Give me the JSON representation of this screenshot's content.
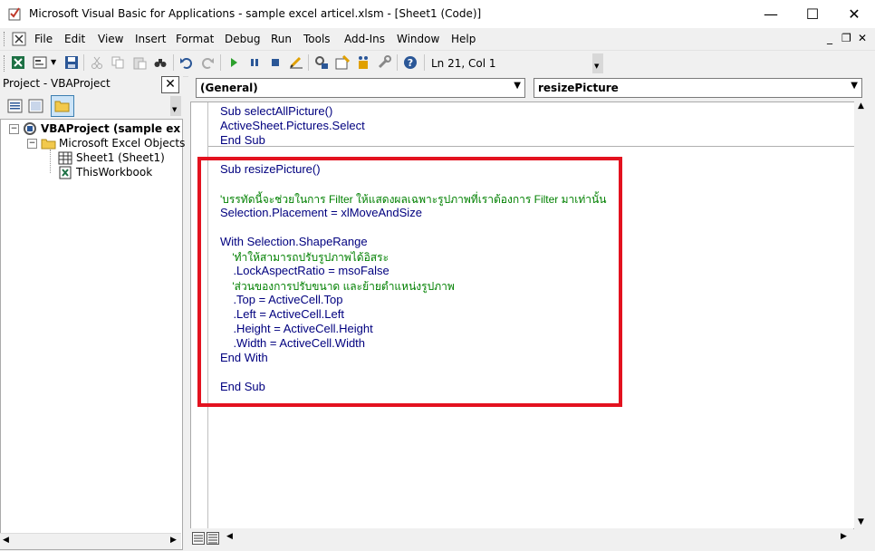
{
  "window": {
    "title": "Microsoft Visual Basic for Applications - sample excel articel.xlsm - [Sheet1 (Code)]",
    "minimize": "—",
    "maximize": "☐",
    "close": "✕"
  },
  "menu": {
    "items": [
      "File",
      "Edit",
      "View",
      "Insert",
      "Format",
      "Debug",
      "Run",
      "Tools",
      "Add-Ins",
      "Window",
      "Help"
    ],
    "mdi_minimize": "_",
    "mdi_restore": "❐",
    "mdi_close": "✕"
  },
  "toolbar": {
    "cursor_position": "Ln 21, Col 1"
  },
  "project": {
    "header": "Project - VBAProject",
    "close": "✕",
    "tree": {
      "root": "VBAProject (sample excel articel.xlsm)",
      "folder": "Microsoft Excel Objects",
      "items": [
        "Sheet1 (Sheet1)",
        "ThisWorkbook"
      ]
    }
  },
  "editor": {
    "object_combo": "(General)",
    "procedure_combo": "resizePicture",
    "block1": [
      "Sub selectAllPicture()",
      "ActiveSheet.Pictures.Select",
      "End Sub"
    ],
    "block2": [
      {
        "text": "Sub resizePicture()",
        "type": "code"
      },
      {
        "text": "",
        "type": "code"
      },
      {
        "text": "'บรรทัดนี้จะช่วยในการ Filter ให้แสดงผลเฉพาะรูปภาพที่เราต้องการ Filter มาเท่านั้น",
        "type": "comment"
      },
      {
        "text": "Selection.Placement = xlMoveAndSize",
        "type": "code"
      },
      {
        "text": "",
        "type": "code"
      },
      {
        "text": "With Selection.ShapeRange",
        "type": "code"
      },
      {
        "text": "    'ทำให้สามารถปรับรูปภาพได้อิสระ",
        "type": "comment"
      },
      {
        "text": "    .LockAspectRatio = msoFalse",
        "type": "code"
      },
      {
        "text": "    'ส่วนของการปรับขนาด และย้ายตำแหน่งรูปภาพ",
        "type": "comment"
      },
      {
        "text": "    .Top = ActiveCell.Top",
        "type": "code"
      },
      {
        "text": "    .Left = ActiveCell.Left",
        "type": "code"
      },
      {
        "text": "    .Height = ActiveCell.Height",
        "type": "code"
      },
      {
        "text": "    .Width = ActiveCell.Width",
        "type": "code"
      },
      {
        "text": "End With",
        "type": "code"
      },
      {
        "text": "",
        "type": "code"
      },
      {
        "text": "End Sub",
        "type": "code"
      }
    ]
  },
  "colors": {
    "highlight_box": "#e3121f",
    "code_text": "#00007f",
    "comment_text": "#008000"
  }
}
